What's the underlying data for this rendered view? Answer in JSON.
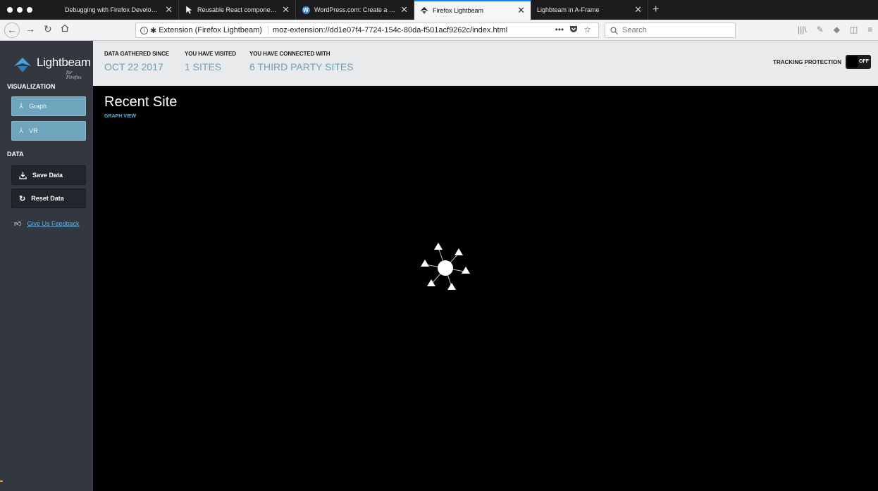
{
  "browser": {
    "tabs": [
      {
        "title": "Debugging with Firefox Developer T",
        "icon": "none",
        "active": false
      },
      {
        "title": "Reusable React component to r",
        "icon": "page-icon",
        "active": false
      },
      {
        "title": "WordPress.com: Create a free w",
        "icon": "wordpress-icon",
        "active": false
      },
      {
        "title": "Firefox Lightbeam",
        "icon": "lightbeam-icon",
        "active": true
      },
      {
        "title": "Lighbteam in A-Frame",
        "icon": "none",
        "active": false
      }
    ],
    "close_glyph": "✕",
    "newtab_glyph": "+",
    "identity_label": "Extension (Firefox Lightbeam)",
    "url": "moz-extension://dd1e07f4-7724-154c-80da-f501acf9262c/index.html",
    "search_placeholder": "Search",
    "accent_color": "#0a84ff"
  },
  "app": {
    "brand": "Lightbeam",
    "brand_sub": "for Firefox",
    "visualization_label": "VISUALIZATION",
    "graph_label": "Graph",
    "vr_label": "VR",
    "data_label": "DATA",
    "save_label": "Save Data",
    "reset_label": "Reset Data",
    "feedback_label": "Give Us Feedback",
    "stats": [
      {
        "label": "DATA GATHERED SINCE",
        "value": "OCT 22 2017"
      },
      {
        "label": "YOU HAVE VISITED",
        "value": "1 SITES"
      },
      {
        "label": "YOU HAVE CONNECTED WITH",
        "value": "6 THIRD PARTY SITES"
      }
    ],
    "tracking_label": "TRACKING PROTECTION",
    "tracking_state": "OFF",
    "view_title": "Recent Site",
    "view_subtitle": "GRAPH VIEW",
    "colors": {
      "sidebar": "#323740",
      "header": "#e9eaec",
      "accent": "#6fa4bd",
      "value_text": "#6a9fb8"
    }
  }
}
